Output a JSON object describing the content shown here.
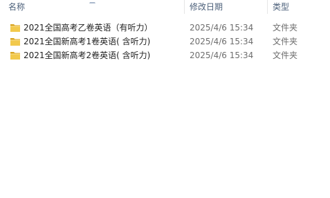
{
  "columns": {
    "name": "名称",
    "date_modified": "修改日期",
    "type": "类型"
  },
  "files": [
    {
      "icon": "folder-icon",
      "name": "2021全国高考乙卷英语（有听力）",
      "date_modified": "2025/4/6 15:34",
      "type": "文件夹"
    },
    {
      "icon": "folder-icon",
      "name": "2021全国新高考1卷英语( 含听力)",
      "date_modified": "2025/4/6 15:34",
      "type": "文件夹"
    },
    {
      "icon": "folder-icon",
      "name": "2021全国新高考2卷英语( 含听力)",
      "date_modified": "2025/4/6 15:34",
      "type": "文件夹"
    }
  ],
  "colors": {
    "folder_front": "#f2c94c",
    "folder_back": "#d9a521",
    "header_text": "#4c607a",
    "secondary_text": "#6d6d6d"
  }
}
